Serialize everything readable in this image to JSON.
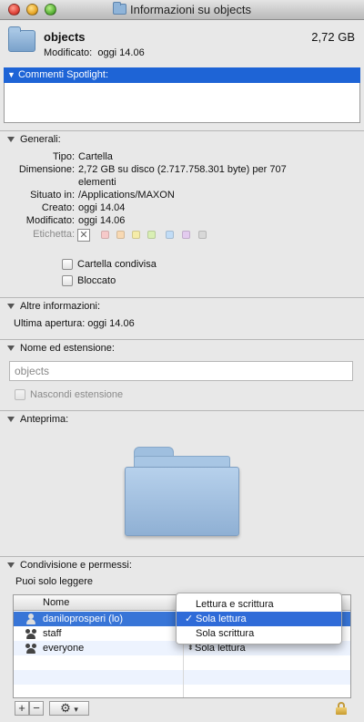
{
  "window": {
    "title": "Informazioni su objects"
  },
  "header": {
    "name": "objects",
    "size": "2,72 GB",
    "modified_label": "Modificato:",
    "modified_value": "oggi 14.06"
  },
  "spotlight": {
    "label": "Commenti Spotlight:"
  },
  "general": {
    "title": "Generali:",
    "rows": {
      "tipo": {
        "label": "Tipo:",
        "value": "Cartella"
      },
      "dimensione": {
        "label": "Dimensione:",
        "value": "2,72 GB su disco (2.717.758.301 byte) per 707",
        "value2": "elementi"
      },
      "situato": {
        "label": "Situato in:",
        "value": "/Applications/MAXON"
      },
      "creato": {
        "label": "Creato:",
        "value": "oggi 14.04"
      },
      "modificato": {
        "label": "Modificato:",
        "value": "oggi 14.06"
      },
      "etichetta": {
        "label": "Etichetta:",
        "none_glyph": "✕"
      }
    },
    "label_colors": [
      "#f6c9c9",
      "#f8d9b3",
      "#f5eca8",
      "#d9efb4",
      "#c1dcf6",
      "#e3cbef",
      "#d8d8d8"
    ],
    "shared_folder": "Cartella condivisa",
    "locked": "Bloccato"
  },
  "more_info": {
    "title": "Altre informazioni:",
    "last_opened": "Ultima apertura: oggi 14.06"
  },
  "name_ext": {
    "title": "Nome ed estensione:",
    "filename": "objects",
    "hide_extension": "Nascondi estensione"
  },
  "preview": {
    "title": "Anteprima:"
  },
  "sharing": {
    "title": "Condivisione e permessi:",
    "info": "Puoi solo leggere",
    "col_name": "Nome",
    "rows": [
      {
        "name": "daniloprosperi (lo)",
        "privilege": ""
      },
      {
        "name": "staff",
        "privilege": ""
      },
      {
        "name": "everyone",
        "privilege": "Sola lettura"
      }
    ],
    "popup": [
      "Lettura e scrittura",
      "Sola lettura",
      "Sola scrittura"
    ],
    "selected_option": "Sola lettura",
    "check_glyph": "✓"
  },
  "toolbar": {
    "add": "+",
    "remove": "−",
    "gear": "⚙",
    "menu_arrow": "▾"
  }
}
